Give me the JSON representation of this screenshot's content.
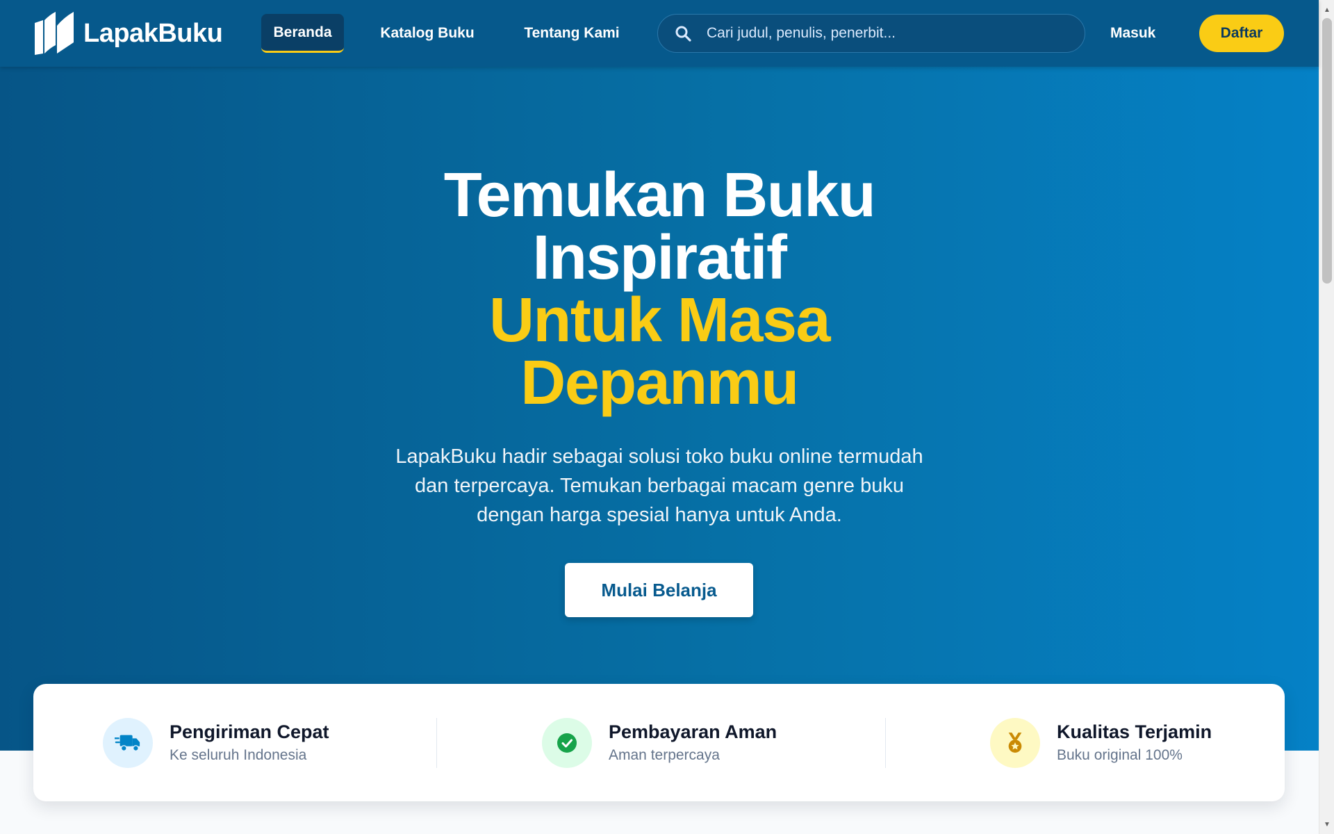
{
  "brand": {
    "name": "LapakBuku"
  },
  "nav": {
    "items": [
      {
        "label": "Beranda",
        "active": true
      },
      {
        "label": "Katalog Buku",
        "active": false
      },
      {
        "label": "Tentang Kami",
        "active": false
      }
    ]
  },
  "search": {
    "placeholder": "Cari judul, penulis, penerbit..."
  },
  "auth": {
    "login_label": "Masuk",
    "register_label": "Daftar"
  },
  "hero": {
    "title_line1": "Temukan Buku",
    "title_line2": "Inspiratif",
    "highlight_line1": "Untuk Masa",
    "highlight_line2": "Depanmu",
    "description": "LapakBuku hadir sebagai solusi toko buku online termudah dan terpercaya. Temukan berbagai macam genre buku dengan harga spesial hanya untuk Anda.",
    "cta_label": "Mulai Belanja"
  },
  "features": [
    {
      "title": "Pengiriman Cepat",
      "subtitle": "Ke seluruh Indonesia",
      "icon": "truck-icon"
    },
    {
      "title": "Pembayaran Aman",
      "subtitle": "Aman terpercaya",
      "icon": "check-circle-icon"
    },
    {
      "title": "Kualitas Terjamin",
      "subtitle": "Buku original 100%",
      "icon": "medal-icon"
    }
  ],
  "colors": {
    "primary": "#06598c",
    "accent": "#facc15",
    "hero_gradient_end": "#0581c6"
  }
}
